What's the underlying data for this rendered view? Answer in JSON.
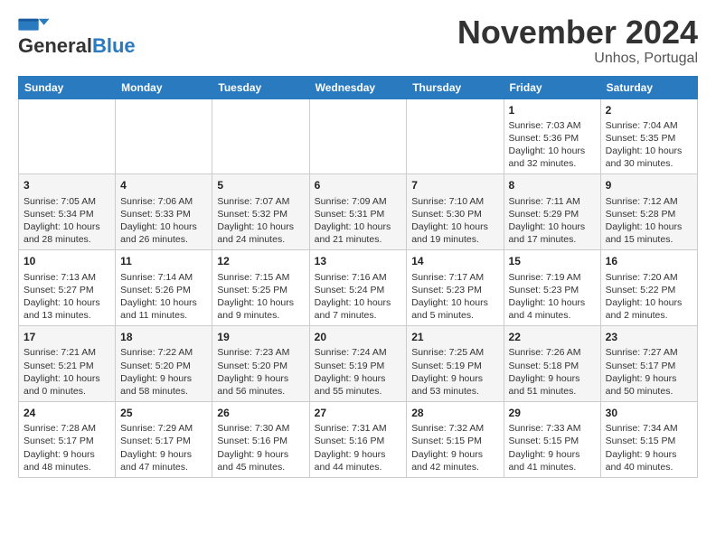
{
  "header": {
    "logo_general": "General",
    "logo_blue": "Blue",
    "title": "November 2024",
    "subtitle": "Unhos, Portugal"
  },
  "days_of_week": [
    "Sunday",
    "Monday",
    "Tuesday",
    "Wednesday",
    "Thursday",
    "Friday",
    "Saturday"
  ],
  "weeks": [
    [
      {
        "day": "",
        "info": ""
      },
      {
        "day": "",
        "info": ""
      },
      {
        "day": "",
        "info": ""
      },
      {
        "day": "",
        "info": ""
      },
      {
        "day": "",
        "info": ""
      },
      {
        "day": "1",
        "info": "Sunrise: 7:03 AM\nSunset: 5:36 PM\nDaylight: 10 hours\nand 32 minutes."
      },
      {
        "day": "2",
        "info": "Sunrise: 7:04 AM\nSunset: 5:35 PM\nDaylight: 10 hours\nand 30 minutes."
      }
    ],
    [
      {
        "day": "3",
        "info": "Sunrise: 7:05 AM\nSunset: 5:34 PM\nDaylight: 10 hours\nand 28 minutes."
      },
      {
        "day": "4",
        "info": "Sunrise: 7:06 AM\nSunset: 5:33 PM\nDaylight: 10 hours\nand 26 minutes."
      },
      {
        "day": "5",
        "info": "Sunrise: 7:07 AM\nSunset: 5:32 PM\nDaylight: 10 hours\nand 24 minutes."
      },
      {
        "day": "6",
        "info": "Sunrise: 7:09 AM\nSunset: 5:31 PM\nDaylight: 10 hours\nand 21 minutes."
      },
      {
        "day": "7",
        "info": "Sunrise: 7:10 AM\nSunset: 5:30 PM\nDaylight: 10 hours\nand 19 minutes."
      },
      {
        "day": "8",
        "info": "Sunrise: 7:11 AM\nSunset: 5:29 PM\nDaylight: 10 hours\nand 17 minutes."
      },
      {
        "day": "9",
        "info": "Sunrise: 7:12 AM\nSunset: 5:28 PM\nDaylight: 10 hours\nand 15 minutes."
      }
    ],
    [
      {
        "day": "10",
        "info": "Sunrise: 7:13 AM\nSunset: 5:27 PM\nDaylight: 10 hours\nand 13 minutes."
      },
      {
        "day": "11",
        "info": "Sunrise: 7:14 AM\nSunset: 5:26 PM\nDaylight: 10 hours\nand 11 minutes."
      },
      {
        "day": "12",
        "info": "Sunrise: 7:15 AM\nSunset: 5:25 PM\nDaylight: 10 hours\nand 9 minutes."
      },
      {
        "day": "13",
        "info": "Sunrise: 7:16 AM\nSunset: 5:24 PM\nDaylight: 10 hours\nand 7 minutes."
      },
      {
        "day": "14",
        "info": "Sunrise: 7:17 AM\nSunset: 5:23 PM\nDaylight: 10 hours\nand 5 minutes."
      },
      {
        "day": "15",
        "info": "Sunrise: 7:19 AM\nSunset: 5:23 PM\nDaylight: 10 hours\nand 4 minutes."
      },
      {
        "day": "16",
        "info": "Sunrise: 7:20 AM\nSunset: 5:22 PM\nDaylight: 10 hours\nand 2 minutes."
      }
    ],
    [
      {
        "day": "17",
        "info": "Sunrise: 7:21 AM\nSunset: 5:21 PM\nDaylight: 10 hours\nand 0 minutes."
      },
      {
        "day": "18",
        "info": "Sunrise: 7:22 AM\nSunset: 5:20 PM\nDaylight: 9 hours\nand 58 minutes."
      },
      {
        "day": "19",
        "info": "Sunrise: 7:23 AM\nSunset: 5:20 PM\nDaylight: 9 hours\nand 56 minutes."
      },
      {
        "day": "20",
        "info": "Sunrise: 7:24 AM\nSunset: 5:19 PM\nDaylight: 9 hours\nand 55 minutes."
      },
      {
        "day": "21",
        "info": "Sunrise: 7:25 AM\nSunset: 5:19 PM\nDaylight: 9 hours\nand 53 minutes."
      },
      {
        "day": "22",
        "info": "Sunrise: 7:26 AM\nSunset: 5:18 PM\nDaylight: 9 hours\nand 51 minutes."
      },
      {
        "day": "23",
        "info": "Sunrise: 7:27 AM\nSunset: 5:17 PM\nDaylight: 9 hours\nand 50 minutes."
      }
    ],
    [
      {
        "day": "24",
        "info": "Sunrise: 7:28 AM\nSunset: 5:17 PM\nDaylight: 9 hours\nand 48 minutes."
      },
      {
        "day": "25",
        "info": "Sunrise: 7:29 AM\nSunset: 5:17 PM\nDaylight: 9 hours\nand 47 minutes."
      },
      {
        "day": "26",
        "info": "Sunrise: 7:30 AM\nSunset: 5:16 PM\nDaylight: 9 hours\nand 45 minutes."
      },
      {
        "day": "27",
        "info": "Sunrise: 7:31 AM\nSunset: 5:16 PM\nDaylight: 9 hours\nand 44 minutes."
      },
      {
        "day": "28",
        "info": "Sunrise: 7:32 AM\nSunset: 5:15 PM\nDaylight: 9 hours\nand 42 minutes."
      },
      {
        "day": "29",
        "info": "Sunrise: 7:33 AM\nSunset: 5:15 PM\nDaylight: 9 hours\nand 41 minutes."
      },
      {
        "day": "30",
        "info": "Sunrise: 7:34 AM\nSunset: 5:15 PM\nDaylight: 9 hours\nand 40 minutes."
      }
    ]
  ]
}
